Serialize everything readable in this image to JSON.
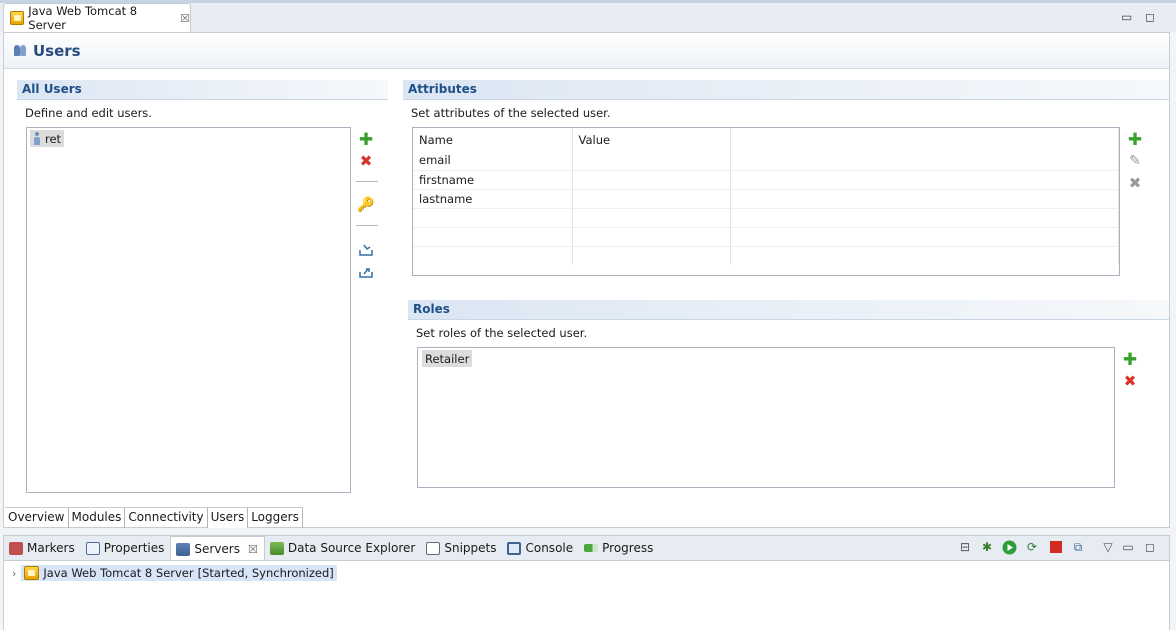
{
  "editor_tab": {
    "title": "Java Web Tomcat 8 Server",
    "close": "☒"
  },
  "window_controls": {
    "minimize": "▭",
    "maximize": "◻"
  },
  "page": {
    "title": "Users"
  },
  "all_users": {
    "heading": "All Users",
    "description": "Define and edit users.",
    "items": [
      "ret"
    ]
  },
  "attributes": {
    "heading": "Attributes",
    "description": "Set attributes of the selected user.",
    "columns": [
      "Name",
      "Value"
    ],
    "rows": [
      {
        "name": "email",
        "value": ""
      },
      {
        "name": "firstname",
        "value": ""
      },
      {
        "name": "lastname",
        "value": ""
      }
    ]
  },
  "roles": {
    "heading": "Roles",
    "description": "Set roles of the selected user.",
    "items": [
      "Retailer"
    ]
  },
  "editor_tabs": [
    "Overview",
    "Modules",
    "Connectivity",
    "Users",
    "Loggers"
  ],
  "active_editor_tab": "Users",
  "views": {
    "tabs": [
      "Markers",
      "Properties",
      "Servers",
      "Data Source Explorer",
      "Snippets",
      "Console",
      "Progress"
    ],
    "active": "Servers",
    "server": {
      "name": "Java Web Tomcat 8 Server",
      "status": "[Started, Synchronized]"
    }
  },
  "icons": {
    "add": "add-icon",
    "remove": "remove-icon",
    "password": "key-icon",
    "import": "import-icon",
    "export": "export-icon",
    "edit": "pencil-icon"
  },
  "colors": {
    "section_title": "#1f4f88",
    "add": "#3aa02c",
    "remove": "#d6342a"
  }
}
